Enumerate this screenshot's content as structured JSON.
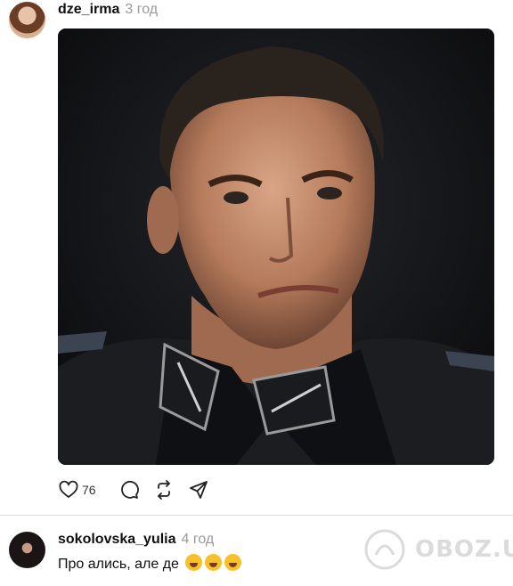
{
  "post": {
    "username": "dze_irma",
    "time": "3 год",
    "likes": "76",
    "icons": [
      "heart-icon",
      "comment-icon",
      "repost-icon",
      "share-icon"
    ]
  },
  "comment": {
    "username": "sokolovska_yulia",
    "time": "4 год",
    "text": "Про  ались, але де",
    "emoji": [
      "rofl-emoji",
      "rofl-emoji",
      "rofl-emoji"
    ]
  },
  "watermark": {
    "text": "OBOZ.UA"
  }
}
